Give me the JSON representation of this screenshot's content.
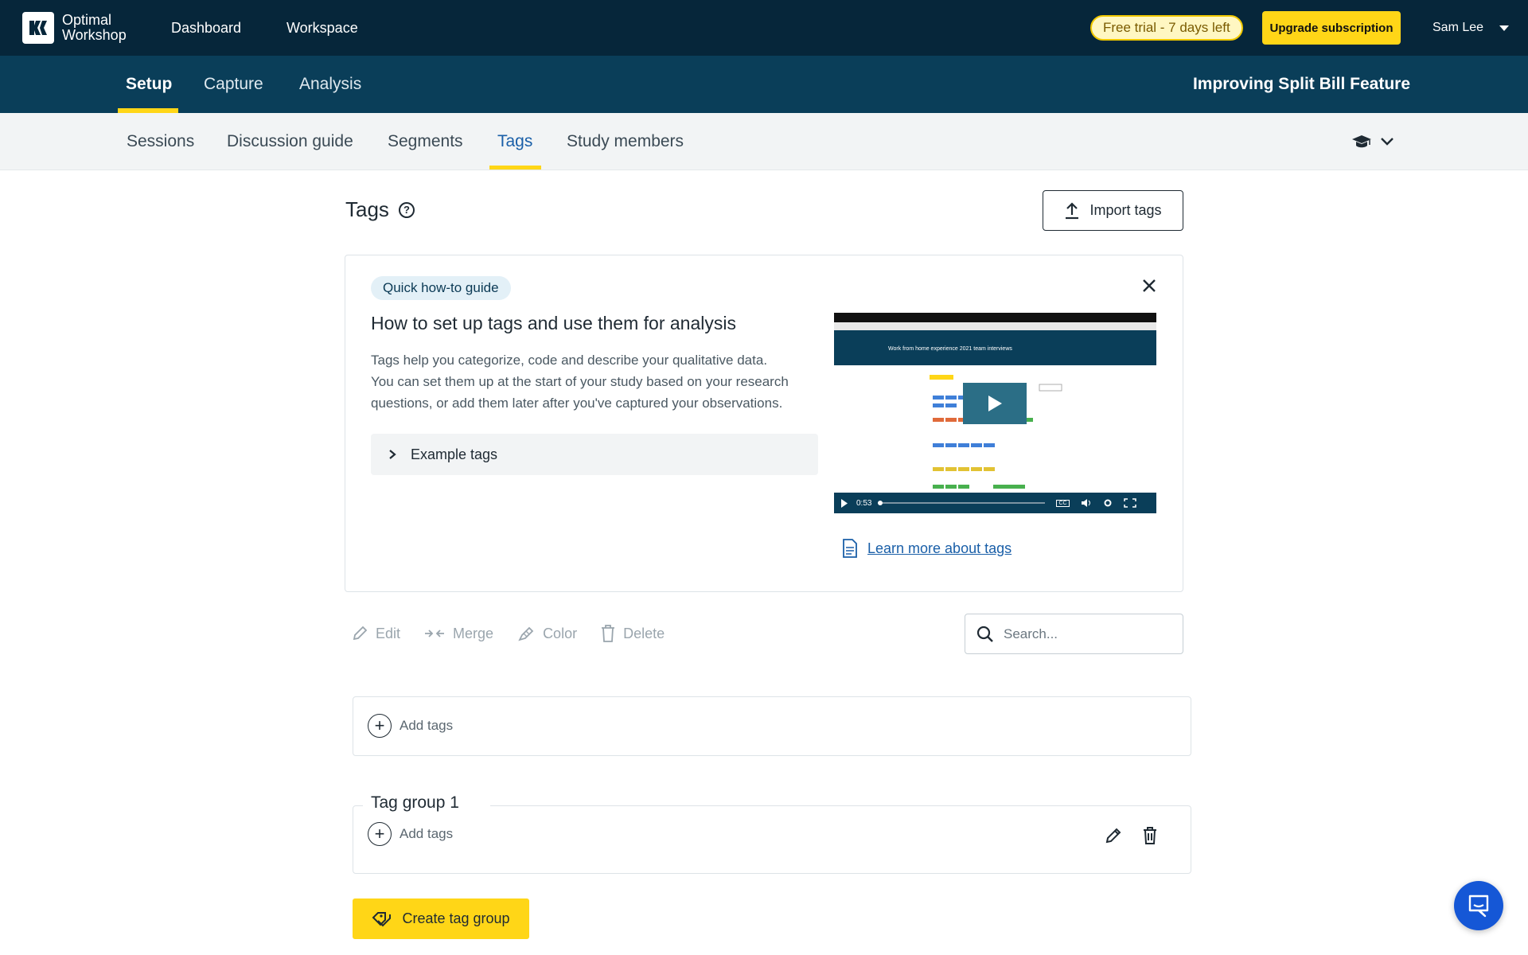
{
  "topbar": {
    "logo_line1": "Optimal",
    "logo_line2": "Workshop",
    "nav": [
      "Dashboard",
      "Workspace"
    ],
    "trial": "Free trial - 7 days left",
    "upgrade": "Upgrade subscription",
    "user": "Sam Lee"
  },
  "secondbar": {
    "tabs": [
      "Setup",
      "Capture",
      "Analysis"
    ],
    "active_tab": "Setup",
    "study_title": "Improving Split Bill Feature"
  },
  "subnav": {
    "tabs": [
      "Sessions",
      "Discussion guide",
      "Segments",
      "Tags",
      "Study members"
    ],
    "active_tab": "Tags"
  },
  "page": {
    "title": "Tags",
    "import_label": "Import tags"
  },
  "guide": {
    "badge": "Quick how-to guide",
    "heading": "How to set up tags and use them for analysis",
    "body_line1": "Tags help you categorize, code and describe your qualitative data.",
    "body_line2": "You can set them up at the start of your study based on your research",
    "body_line3": "questions, or add them later after you've captured your observations.",
    "example_tags": "Example tags",
    "video_time": "0:53",
    "video_title": "Work from home experience 2021 team interviews",
    "learn_more": "Learn more about tags"
  },
  "toolbar": {
    "edit": "Edit",
    "merge": "Merge",
    "color": "Color",
    "delete": "Delete",
    "search_placeholder": "Search..."
  },
  "tags": {
    "add_label": "Add tags",
    "group_name": "Tag group 1",
    "group_add_label": "Add tags",
    "create_group": "Create tag group"
  },
  "colors": {
    "topbar": "#06263a",
    "secondbar": "#0a3e59",
    "accent": "#ffd617",
    "link": "#1a5fa8",
    "chat": "#1557d6"
  }
}
